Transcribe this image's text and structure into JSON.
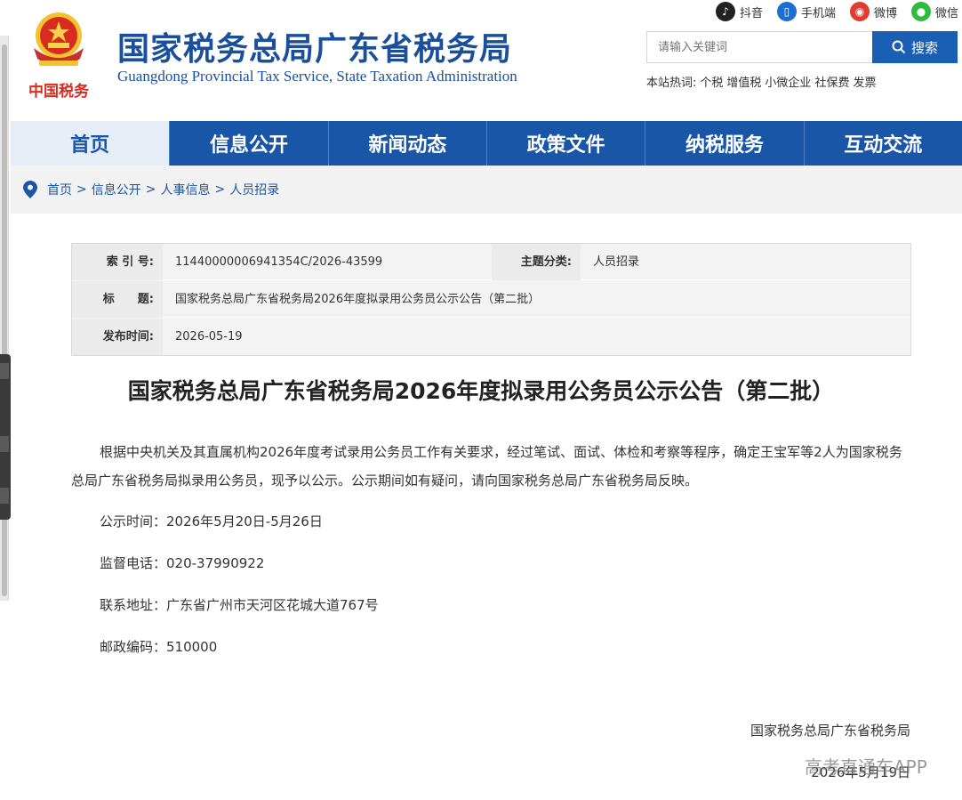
{
  "header": {
    "title_cn": "国家税务总局广东省税务局",
    "title_en": "Guangdong Provincial Tax Service, State Taxation Administration",
    "emblem_caption": "中国税务",
    "social": [
      {
        "label": "抖音",
        "icon": "tiktok-icon",
        "color": "#222222"
      },
      {
        "label": "手机端",
        "icon": "mobile-icon",
        "color": "#1a6fd1"
      },
      {
        "label": "微博",
        "icon": "weibo-icon",
        "color": "#e03c2f"
      },
      {
        "label": "微信",
        "icon": "wechat-icon",
        "color": "#2ebc3e"
      }
    ],
    "search": {
      "placeholder": "请输入关键词",
      "button_label": "搜索"
    },
    "hot": {
      "label": "本站热词:",
      "keywords": [
        "个税",
        "增值税",
        "小微企业",
        "社保费",
        "发票"
      ]
    }
  },
  "nav": {
    "items": [
      "首页",
      "信息公开",
      "新闻动态",
      "政策文件",
      "纳税服务",
      "互动交流"
    ],
    "active_index": 0
  },
  "breadcrumb": [
    "首页",
    "信息公开",
    "人事信息",
    "人员招录"
  ],
  "meta": {
    "index_label": "索 引 号:",
    "index_value": "11440000006941354C/2026-43599",
    "topic_label": "主题分类:",
    "topic_value": "人员招录",
    "title_label": "标　　题:",
    "title_value": "国家税务总局广东省税务局2026年度拟录用公务员公示公告（第二批）",
    "date_label": "发布时间:",
    "date_value": "2026-05-19"
  },
  "article": {
    "title": "国家税务总局广东省税务局2026年度拟录用公务员公示公告（第二批）",
    "paragraph": "根据中央机关及其直属机构2026年度考试录用公务员工作有关要求，经过笔试、面试、体检和考察等程序，确定王宝军等2人为国家税务总局广东省税务局拟录用公务员，现予以公示。公示期间如有疑问，请向国家税务总局广东省税务局反映。",
    "lines": [
      "公示时间：2026年5月20日-5月26日",
      "监督电话：020-37990922",
      "联系地址：广东省广州市天河区花城大道767号",
      "邮政编码：510000"
    ],
    "signature_org": "国家税务总局广东省税务局",
    "signature_date": "2026年5月19日"
  },
  "watermark": "高考直通车APP",
  "colors": {
    "brand_blue": "#1a56a8",
    "nav_active_bg": "#e7edf6",
    "search_button": "#1a5fb4"
  }
}
